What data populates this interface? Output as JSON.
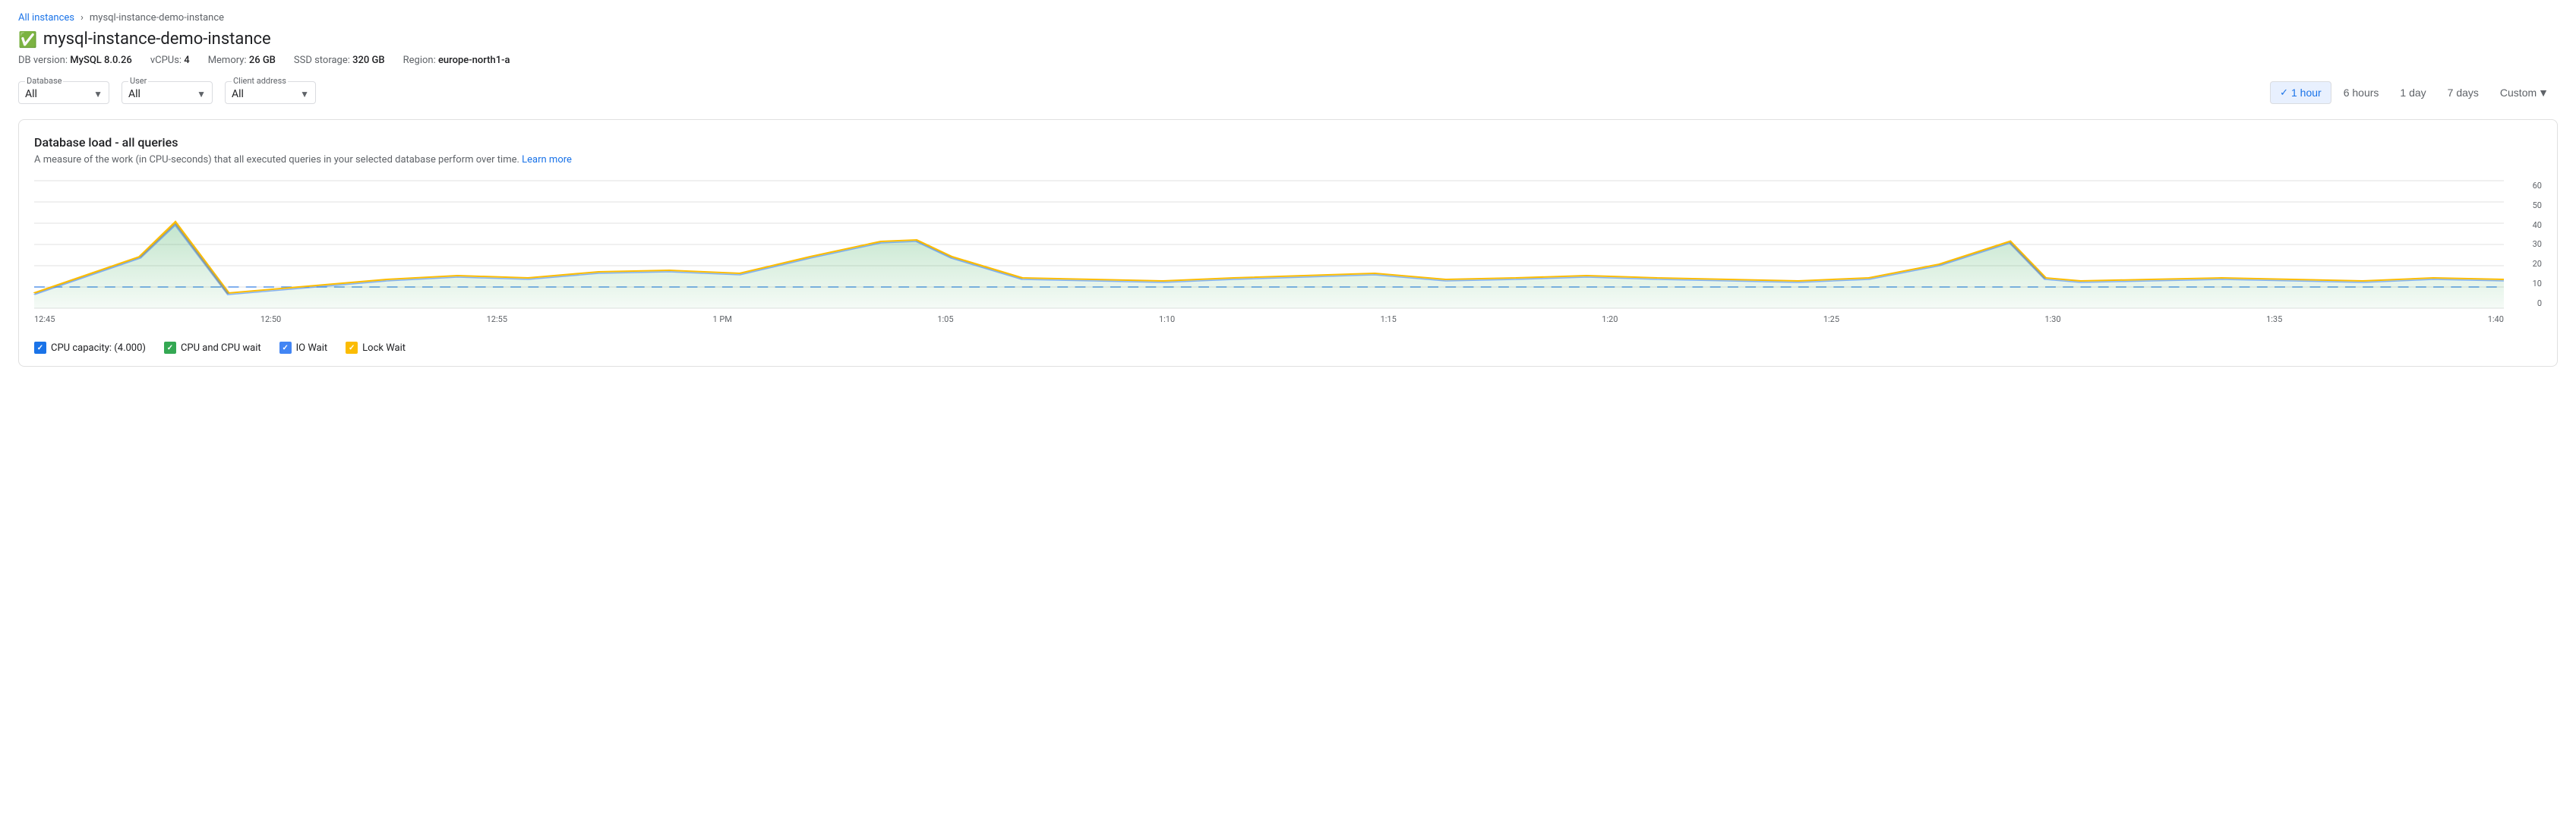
{
  "breadcrumb": {
    "parent_label": "All instances",
    "separator": "›",
    "current": "mysql-instance-demo-instance"
  },
  "instance": {
    "name": "mysql-instance-demo-instance",
    "status_icon": "✓",
    "db_version_label": "DB version:",
    "db_version": "MySQL 8.0.26",
    "vcpus_label": "vCPUs:",
    "vcpus": "4",
    "memory_label": "Memory:",
    "memory": "26 GB",
    "ssd_label": "SSD storage:",
    "ssd": "320 GB",
    "region_label": "Region:",
    "region": "europe-north1-a"
  },
  "filters": {
    "database": {
      "label": "Database",
      "value": "All"
    },
    "user": {
      "label": "User",
      "value": "All"
    },
    "client_address": {
      "label": "Client address",
      "value": "All"
    }
  },
  "time_range": {
    "options": [
      {
        "id": "1hour",
        "label": "1 hour",
        "active": true
      },
      {
        "id": "6hours",
        "label": "6 hours",
        "active": false
      },
      {
        "id": "1day",
        "label": "1 day",
        "active": false
      },
      {
        "id": "7days",
        "label": "7 days",
        "active": false
      },
      {
        "id": "custom",
        "label": "Custom",
        "active": false,
        "has_dropdown": true
      }
    ]
  },
  "chart": {
    "title": "Database load - all queries",
    "description": "A measure of the work (in CPU-seconds) that all executed queries in your selected database perform over time.",
    "learn_more": "Learn more",
    "y_axis": [
      "60",
      "50",
      "40",
      "30",
      "20",
      "10",
      "0"
    ],
    "x_axis": [
      "12:45",
      "12:50",
      "12:55",
      "1 PM",
      "1:05",
      "1:10",
      "1:15",
      "1:20",
      "1:25",
      "1:30",
      "1:35",
      "1:40"
    ],
    "legend": [
      {
        "id": "cpu-capacity",
        "label": "CPU capacity: (4.000)",
        "color": "#1a73e8",
        "type": "checkbox"
      },
      {
        "id": "cpu-wait",
        "label": "CPU and CPU wait",
        "color": "#34a853",
        "type": "checkbox"
      },
      {
        "id": "io-wait",
        "label": "IO Wait",
        "color": "#4285f4",
        "type": "checkbox"
      },
      {
        "id": "lock-wait",
        "label": "Lock Wait",
        "color": "#fbbc04",
        "type": "checkbox"
      }
    ]
  }
}
